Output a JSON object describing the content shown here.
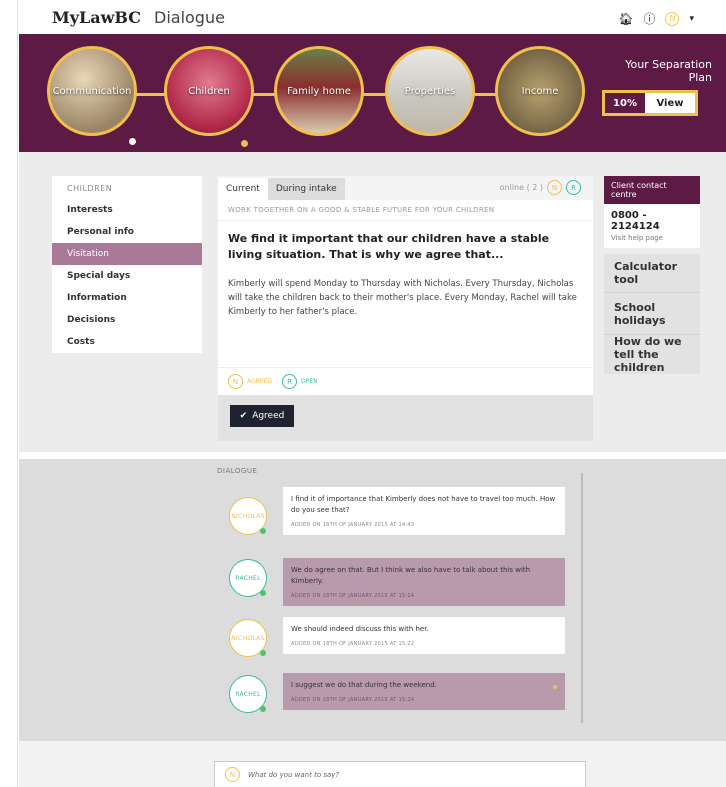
{
  "header": {
    "brand": "MyLawBC",
    "section": "Dialogue",
    "user_initial": "N"
  },
  "timeline": {
    "topics": [
      "Communication",
      "Children",
      "Family home",
      "Properties",
      "Income"
    ]
  },
  "plan": {
    "title": "Your Separation Plan",
    "progress": "10%",
    "view_label": "View"
  },
  "sidenav": {
    "heading": "CHILDREN",
    "items": [
      "Interests",
      "Personal info",
      "Visitation",
      "Special days",
      "Information",
      "Decisions",
      "Costs"
    ],
    "active": "Visitation"
  },
  "card": {
    "tabs": [
      "Current",
      "During intake"
    ],
    "online": "online ( 2 )",
    "avatar_n": "N",
    "avatar_r": "R",
    "subtitle": "WORK TOGETHER ON A GOOD & STABLE FUTURE FOR YOUR CHILDREN",
    "heading": "We find it important that our children have a stable living situation. That is why we agree that...",
    "body": "Kimberly will spend Monday to Thursday with Nicholas. Every Thursday, Nicholas will take the children back to their mother's place. Every Monday, Rachel will take Kimberly to her father's place.",
    "status_agreed": "AGREED",
    "status_open": "OPEN",
    "agreed_button": "Agreed"
  },
  "contact": {
    "title": "Client contact centre",
    "phone": "0800 - 2124124",
    "link": "Visit help page"
  },
  "tools": [
    "Calculator tool",
    "School holidays",
    "How do we tell the children"
  ],
  "dialogue": {
    "label": "DIALOGUE",
    "messages": [
      {
        "author": "NICHOLAS",
        "text": "I find it of importance that Kimberly does not have to travel too much. How do you see that?",
        "date": "ADDED ON 18TH OF JANUARY 2015 AT 14:43"
      },
      {
        "author": "RACHEL",
        "text": "We do agree on that. But I think we also have to talk about this with Kimberly.",
        "date": "ADDED ON 18TH OF JANUARY 2015 AT 15:14"
      },
      {
        "author": "NICHOLAS",
        "text": "We should indeed discuss this with her.",
        "date": "ADDED ON 18TH OF JANUARY 2015 AT 15:22"
      },
      {
        "author": "RACHEL",
        "text": "I suggest we do that during the weekend.",
        "date": "ADDED ON 18TH OF JANUARY 2015 AT 15:24"
      }
    ]
  },
  "composer": {
    "avatar": "N",
    "placeholder": "What do you want to say?"
  },
  "colors": {
    "plum": "#5c1a45",
    "accent_yellow": "#f0c04c",
    "teal": "#3bb8a4",
    "active_nav": "#a87a98"
  }
}
